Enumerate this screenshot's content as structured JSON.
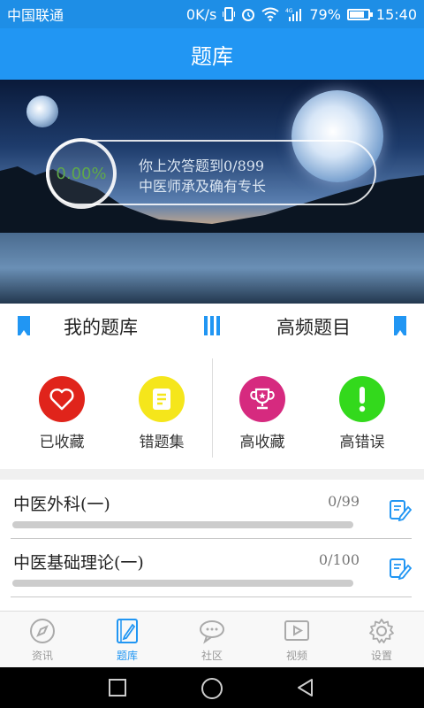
{
  "status_bar": {
    "carrier": "中国联通",
    "net_speed": "0K/s",
    "battery_percent": "79%",
    "battery_level": 0.79,
    "time": "15:40"
  },
  "header": {
    "title": "题库"
  },
  "banner": {
    "progress_percent": "0.00%",
    "line1": "你上次答题到0/899",
    "line2": "中医师承及确有专长"
  },
  "categories": {
    "left_label": "我的题库",
    "right_label": "高频题目"
  },
  "features": [
    {
      "label": "已收藏",
      "icon": "heart-icon",
      "color": "#e0241b"
    },
    {
      "label": "错题集",
      "icon": "notes-icon",
      "color": "#f5e61b"
    },
    {
      "label": "高收藏",
      "icon": "trophy-icon",
      "color": "#d62a7f"
    },
    {
      "label": "高错误",
      "icon": "exclamation-icon",
      "color": "#33d91c"
    }
  ],
  "courses": [
    {
      "title": "中医外科(一)",
      "count": "0/99"
    },
    {
      "title": "中医基础理论(一)",
      "count": "0/100"
    }
  ],
  "tabs": [
    {
      "label": "资讯",
      "icon": "compass-icon"
    },
    {
      "label": "题库",
      "icon": "edit-book-icon"
    },
    {
      "label": "社区",
      "icon": "chat-icon"
    },
    {
      "label": "视频",
      "icon": "video-icon"
    },
    {
      "label": "设置",
      "icon": "gear-icon"
    }
  ],
  "colors": {
    "accent": "#2196f3"
  }
}
